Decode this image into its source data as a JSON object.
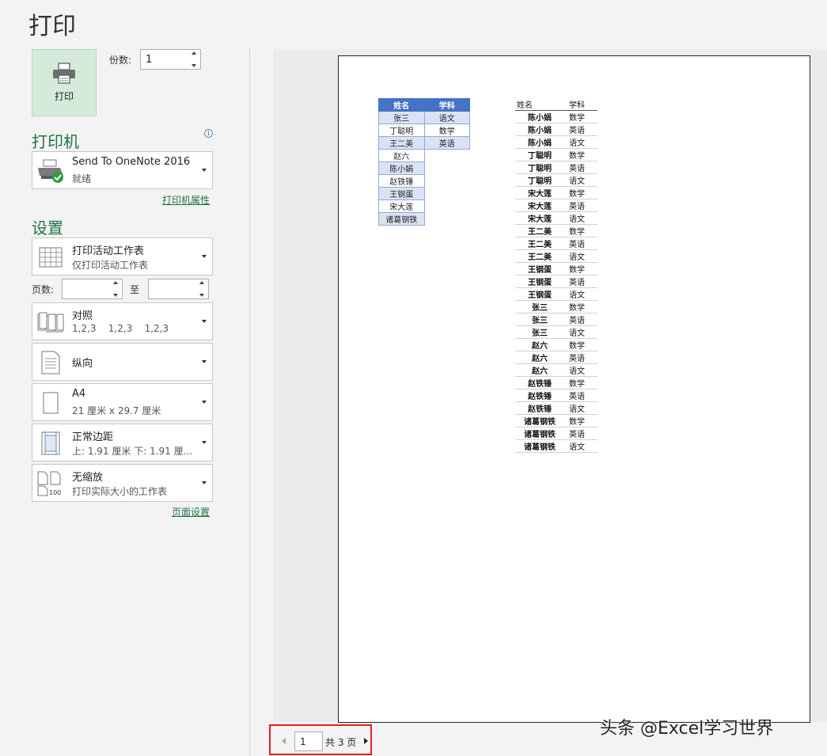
{
  "title": "打印",
  "print_button": {
    "label": "打印",
    "icon": "printer-icon"
  },
  "copies": {
    "label": "份数:",
    "value": "1"
  },
  "printer": {
    "heading": "打印机",
    "info_icon": "i",
    "name": "Send To OneNote 2016",
    "status": "就绪",
    "properties_link": "打印机属性"
  },
  "settings": {
    "heading": "设置",
    "print_what": {
      "title": "打印活动工作表",
      "subtitle": "仅打印活动工作表"
    },
    "pages": {
      "label": "页数:",
      "to_label": "至",
      "from_value": "",
      "to_value": ""
    },
    "collate": {
      "title": "对照",
      "subtitle": "1,2,3    1,2,3    1,2,3"
    },
    "orientation": {
      "title": "纵向"
    },
    "paper": {
      "title": "A4",
      "subtitle": "21 厘米 x 29.7 厘米"
    },
    "margins": {
      "title": "正常边距",
      "subtitle": "上: 1.91 厘米 下: 1.91 厘..."
    },
    "scaling": {
      "title": "无缩放",
      "subtitle": "打印实际大小的工作表"
    },
    "page_setup_link": "页面设置"
  },
  "preview": {
    "table1": {
      "headers": [
        "姓名",
        "学科"
      ],
      "rows": [
        [
          "张三",
          "语文"
        ],
        [
          "丁聪明",
          "数学"
        ],
        [
          "王二美",
          "英语"
        ],
        [
          "赵六",
          ""
        ],
        [
          "陈小娟",
          ""
        ],
        [
          "赵铁锤",
          ""
        ],
        [
          "王钢蛋",
          ""
        ],
        [
          "宋大莲",
          ""
        ],
        [
          "诸葛钢铁",
          ""
        ]
      ]
    },
    "table2": {
      "headers": [
        "姓名",
        "学科"
      ],
      "rows": [
        [
          "陈小娟",
          "数学"
        ],
        [
          "陈小娟",
          "英语"
        ],
        [
          "陈小娟",
          "语文"
        ],
        [
          "丁聪明",
          "数学"
        ],
        [
          "丁聪明",
          "英语"
        ],
        [
          "丁聪明",
          "语文"
        ],
        [
          "宋大莲",
          "数学"
        ],
        [
          "宋大莲",
          "英语"
        ],
        [
          "宋大莲",
          "语文"
        ],
        [
          "王二美",
          "数学"
        ],
        [
          "王二美",
          "英语"
        ],
        [
          "王二美",
          "语文"
        ],
        [
          "王钢蛋",
          "数学"
        ],
        [
          "王钢蛋",
          "英语"
        ],
        [
          "王钢蛋",
          "语文"
        ],
        [
          "张三",
          "数学"
        ],
        [
          "张三",
          "英语"
        ],
        [
          "张三",
          "语文"
        ],
        [
          "赵六",
          "数学"
        ],
        [
          "赵六",
          "英语"
        ],
        [
          "赵六",
          "语文"
        ],
        [
          "赵铁锤",
          "数学"
        ],
        [
          "赵铁锤",
          "英语"
        ],
        [
          "赵铁锤",
          "语文"
        ],
        [
          "诸葛钢铁",
          "数学"
        ],
        [
          "诸葛钢铁",
          "英语"
        ],
        [
          "诸葛钢铁",
          "语文"
        ]
      ]
    }
  },
  "pager": {
    "current": "1",
    "total_text": "共 3 页"
  },
  "watermark": "头条 @Excel学习世界",
  "colors": {
    "accent": "#217346",
    "table_header": "#4472c4",
    "highlight": "#e02020"
  }
}
